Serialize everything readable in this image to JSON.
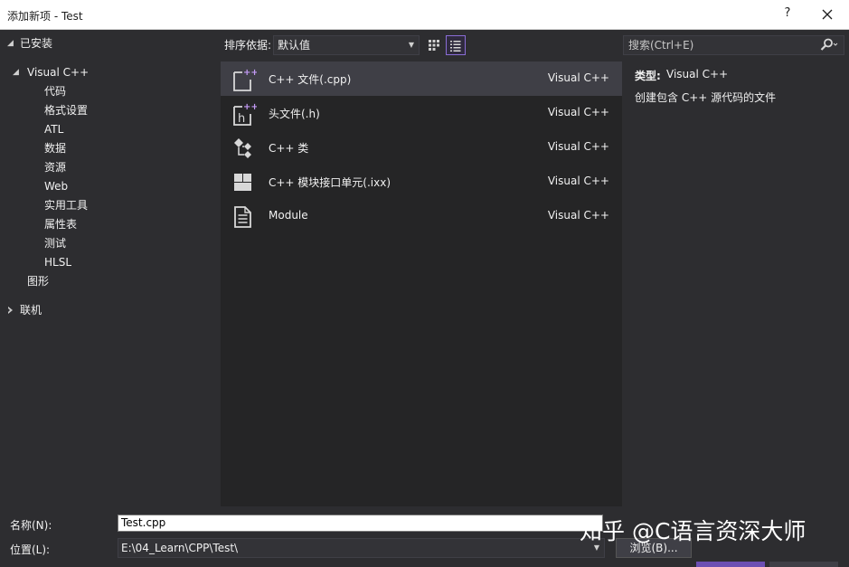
{
  "window": {
    "title": "添加新项 - Test",
    "help": "?",
    "close": "✕"
  },
  "tree": {
    "installed": "已安装",
    "visual_cpp": "Visual C++",
    "children": [
      "代码",
      "格式设置",
      "ATL",
      "数据",
      "资源",
      "Web",
      "实用工具",
      "属性表",
      "测试",
      "HLSL"
    ],
    "graphics": "图形",
    "online": "联机"
  },
  "toolbar": {
    "sort_label": "排序依据:",
    "sort_value": "默认值",
    "search_placeholder": "搜索(Ctrl+E)"
  },
  "templates": [
    {
      "name": "C++ 文件(.cpp)",
      "lang": "Visual C++",
      "icon": "cpp-file-icon",
      "selected": true
    },
    {
      "name": "头文件(.h)",
      "lang": "Visual C++",
      "icon": "header-file-icon",
      "selected": false
    },
    {
      "name": "C++ 类",
      "lang": "Visual C++",
      "icon": "cpp-class-icon",
      "selected": false
    },
    {
      "name": "C++ 模块接口单元(.ixx)",
      "lang": "Visual C++",
      "icon": "module-interface-icon",
      "selected": false
    },
    {
      "name": "Module",
      "lang": "Visual C++",
      "icon": "module-document-icon",
      "selected": false
    }
  ],
  "details": {
    "type_label": "类型:",
    "type_value": "Visual C++",
    "description": "创建包含 C++ 源代码的文件"
  },
  "form": {
    "name_label": "名称(N):",
    "name_value": "Test.cpp",
    "location_label": "位置(L):",
    "location_value": "E:\\04_Learn\\CPP\\Test\\",
    "browse_label": "浏览(B)..."
  },
  "watermark": "知乎 @C语言资深大师",
  "colors": {
    "accent": "#8a6dd6",
    "icon_badge": "#c39af5",
    "selected_row": "#3f3f46"
  }
}
